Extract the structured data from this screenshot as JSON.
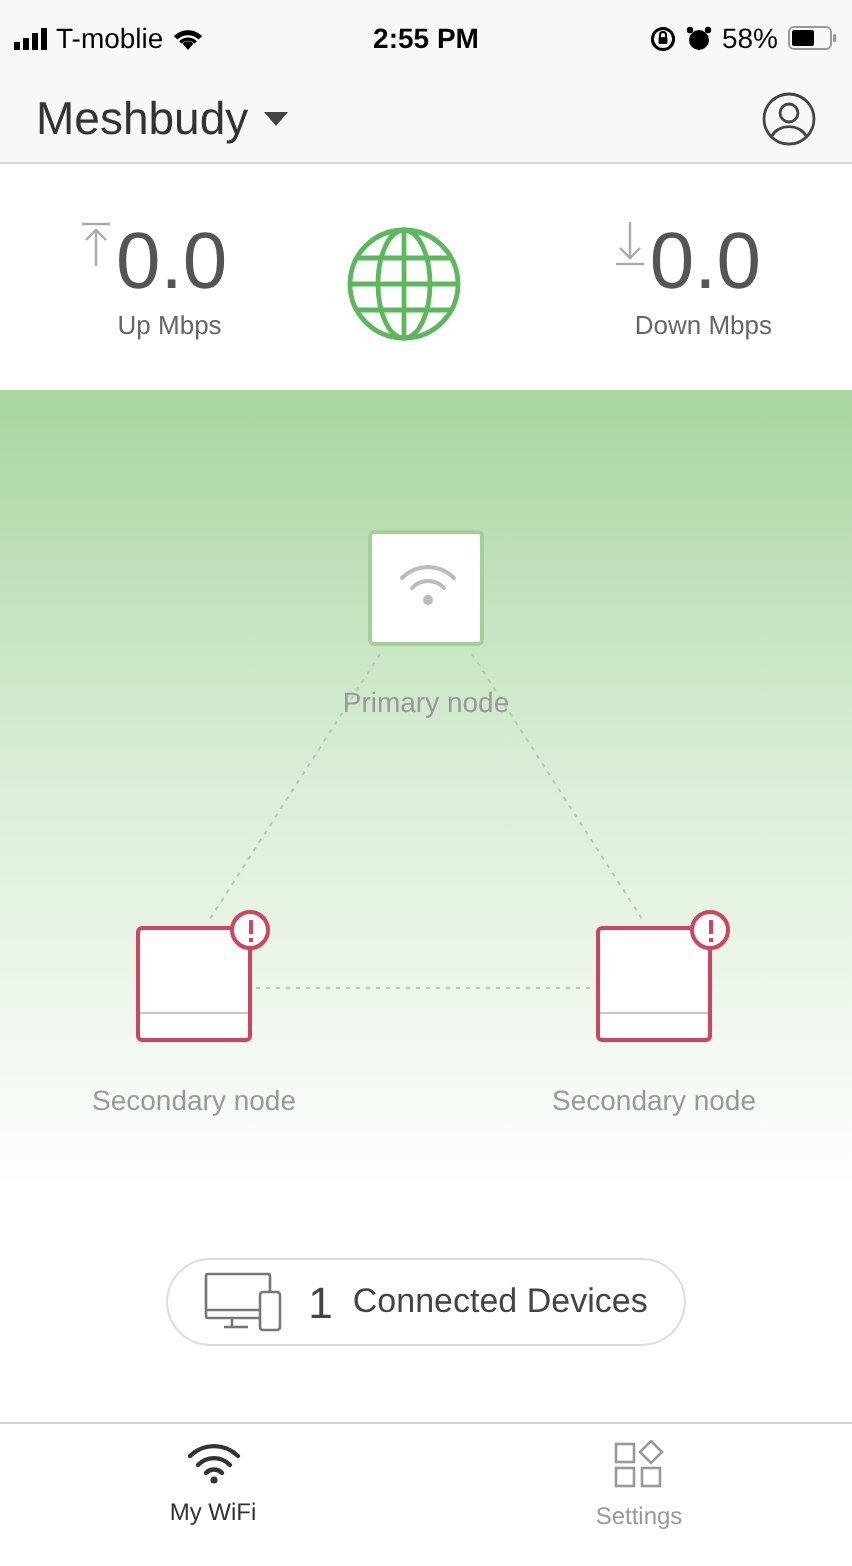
{
  "status_bar": {
    "carrier": "T-moblie",
    "time": "2:55 PM",
    "battery": "58%"
  },
  "header": {
    "title": "Meshbudy"
  },
  "speeds": [
    {
      "kind": "up",
      "value": "0.0",
      "label": "Up Mbps"
    },
    {
      "kind": "down",
      "value": "0.0",
      "label": "Down Mbps"
    }
  ],
  "nodes": [
    {
      "label": "Primary node",
      "alert": false
    },
    {
      "label": "Secondary node",
      "alert": true
    },
    {
      "label": "Secondary node",
      "alert": true
    }
  ],
  "connected": {
    "count": "1",
    "label": "Connected Devices"
  },
  "tabs": [
    {
      "kind": "wifi",
      "label": "My WiFi",
      "selected": true
    },
    {
      "kind": "settings",
      "label": "Settings",
      "selected": false
    }
  ]
}
